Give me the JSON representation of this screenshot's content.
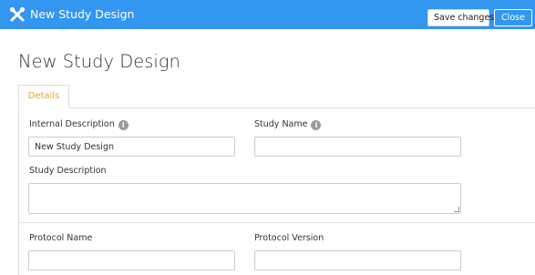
{
  "header": {
    "title": "New Study Design",
    "save_label": "Save changes",
    "close_label": "Close",
    "app_icon": "tools-icon",
    "background_color": "#3396f0"
  },
  "page": {
    "title": "New Study Design"
  },
  "tabs": [
    {
      "label": "Details",
      "active": true
    }
  ],
  "form": {
    "internal_description": {
      "label": "Internal Description",
      "value": "New Study Design",
      "info_icon": "info-icon"
    },
    "study_name": {
      "label": "Study Name",
      "value": "",
      "info_icon": "info-icon"
    },
    "study_description": {
      "label": "Study Description",
      "value": ""
    },
    "protocol_name": {
      "label": "Protocol Name",
      "value": ""
    },
    "protocol_version": {
      "label": "Protocol Version",
      "value": ""
    }
  },
  "colors": {
    "accent": "#3396f0",
    "tab_active_text": "#f0a21c",
    "border": "#dddddd"
  }
}
